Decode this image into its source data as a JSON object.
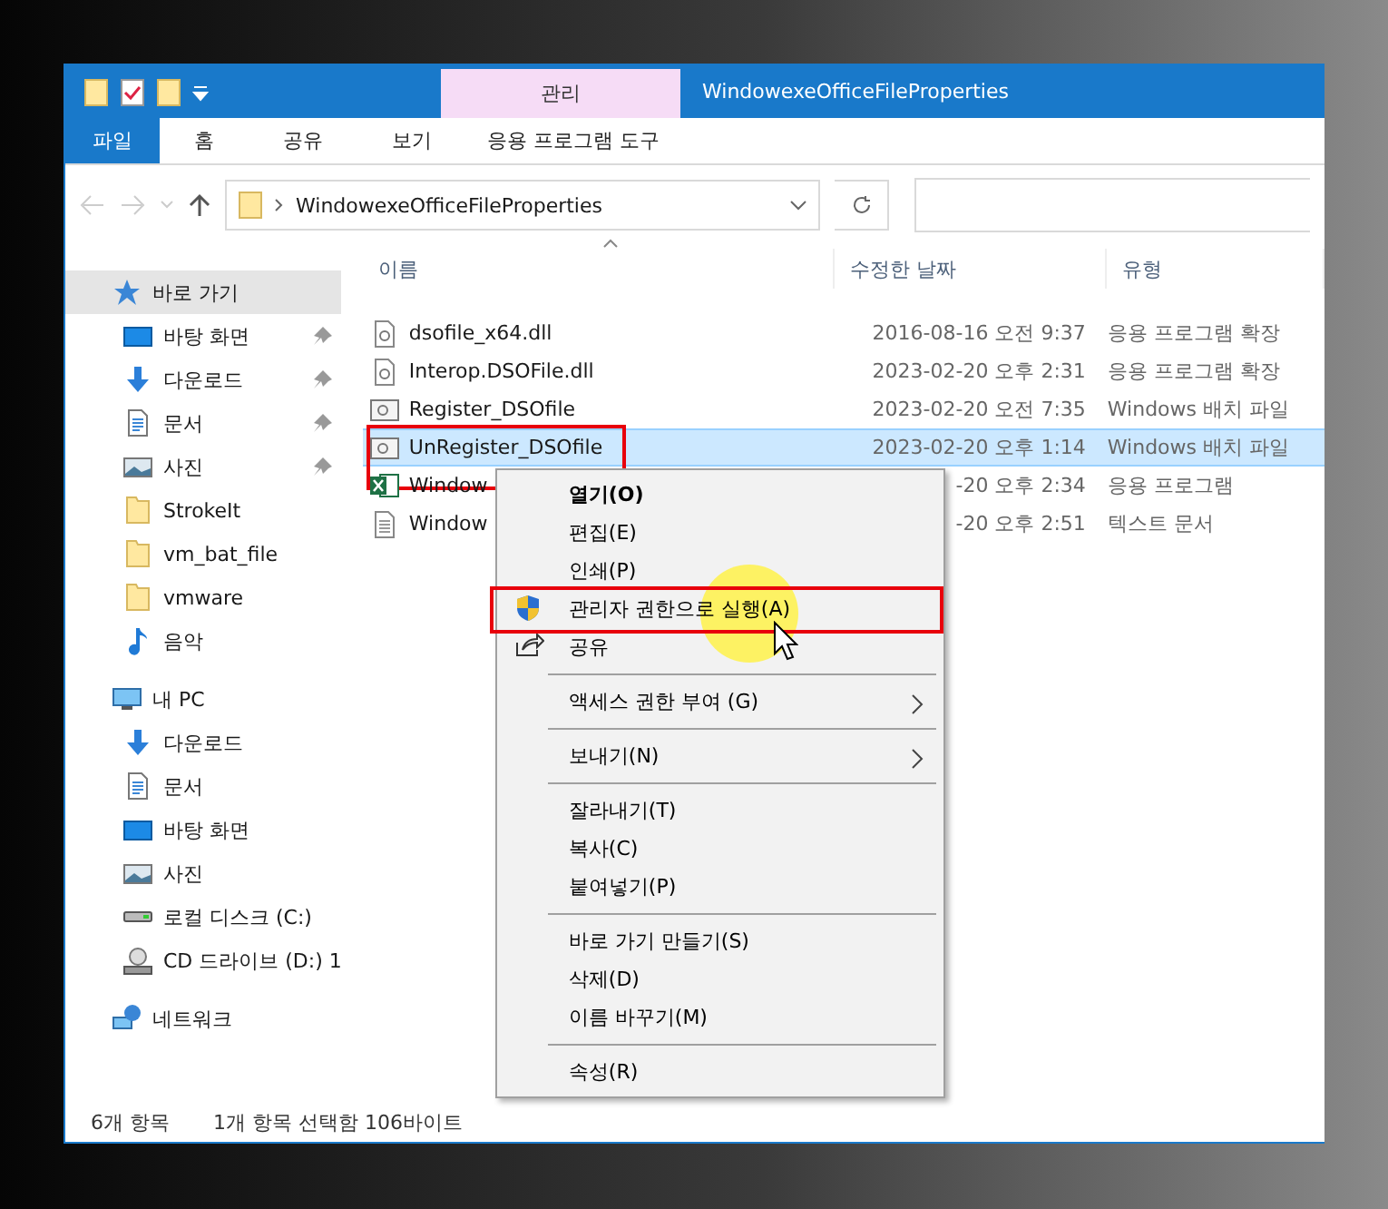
{
  "window": {
    "title": "WindowexeOfficeFileProperties"
  },
  "ribbon": {
    "context_group": "관리",
    "context_tab": "응용 프로그램 도구",
    "tabs": [
      {
        "label": "파일",
        "kind": "file"
      },
      {
        "label": "홈",
        "kind": "tab"
      },
      {
        "label": "공유",
        "kind": "tab"
      },
      {
        "label": "보기",
        "kind": "tab"
      }
    ]
  },
  "address_bar": {
    "path": "WindowexeOfficeFileProperties"
  },
  "navigation": {
    "items": [
      {
        "label": "바로 가기",
        "kind": "star",
        "selected": true,
        "children": [
          {
            "label": "바탕 화면",
            "kind": "desktop",
            "selected": false,
            "pinned": true
          },
          {
            "label": "다운로드",
            "kind": "download",
            "selected": false,
            "pinned": true
          },
          {
            "label": "문서",
            "kind": "document",
            "selected": false,
            "pinned": true
          },
          {
            "label": "사진",
            "kind": "pictures",
            "selected": false,
            "pinned": true
          },
          {
            "label": "StrokeIt",
            "kind": "folder",
            "selected": false,
            "pinned": false
          },
          {
            "label": "vm_bat_file",
            "kind": "folder",
            "selected": false,
            "pinned": false
          },
          {
            "label": "vmware",
            "kind": "folder",
            "selected": false,
            "pinned": false
          },
          {
            "label": "음악",
            "kind": "music",
            "selected": false,
            "pinned": false
          }
        ]
      },
      {
        "label": "내 PC",
        "kind": "pc",
        "selected": false,
        "children": [
          {
            "label": "다운로드",
            "kind": "download",
            "selected": false,
            "pinned": false
          },
          {
            "label": "문서",
            "kind": "document",
            "selected": false,
            "pinned": false
          },
          {
            "label": "바탕 화면",
            "kind": "desktop",
            "selected": false,
            "pinned": false
          },
          {
            "label": "사진",
            "kind": "pictures",
            "selected": false,
            "pinned": false
          },
          {
            "label": "로컬 디스크 (C:)",
            "kind": "disk",
            "selected": false,
            "pinned": false
          },
          {
            "label": "CD 드라이브 (D:) 1",
            "kind": "cd",
            "selected": false,
            "pinned": false
          }
        ]
      },
      {
        "label": "네트워크",
        "kind": "network",
        "selected": false
      }
    ]
  },
  "files": {
    "columns": [
      {
        "label": "이름",
        "sorted": true
      },
      {
        "label": "수정한 날짜",
        "sorted": false
      },
      {
        "label": "유형",
        "sorted": false
      }
    ],
    "rows": [
      {
        "name": "dsofile_x64.dll",
        "date": "2016-08-16 오전 9:37",
        "type": "응용 프로그램 확장",
        "kind": "dll",
        "selected": false,
        "outlined": false
      },
      {
        "name": "Interop.DSOFile.dll",
        "date": "2023-02-20 오후 2:31",
        "type": "응용 프로그램 확장",
        "kind": "dll",
        "selected": false,
        "outlined": false
      },
      {
        "name": "Register_DSOfile",
        "date": "2023-02-20 오전 7:35",
        "type": "Windows 배치 파일",
        "kind": "bat",
        "selected": false,
        "outlined": false
      },
      {
        "name": "UnRegister_DSOfile",
        "date": "2023-02-20 오후 1:14",
        "type": "Windows 배치 파일",
        "kind": "bat",
        "selected": true,
        "outlined": true
      },
      {
        "name": "Window",
        "date": "-20 오후 2:34",
        "type": "응용 프로그램",
        "kind": "excel",
        "selected": false,
        "outlined": false
      },
      {
        "name": "Window",
        "date": "-20 오후 2:51",
        "type": "텍스트 문서",
        "kind": "text",
        "selected": false,
        "outlined": false
      }
    ]
  },
  "context_menu": {
    "items": [
      {
        "kind": "item",
        "label": "열기(O)",
        "default": true,
        "submenu": false,
        "outlined": false
      },
      {
        "kind": "item",
        "label": "편집(E)",
        "default": false,
        "submenu": false,
        "outlined": false
      },
      {
        "kind": "item",
        "label": "인쇄(P)",
        "default": false,
        "submenu": false,
        "outlined": false
      },
      {
        "kind": "shield",
        "label": "관리자 권한으로 실행(A)",
        "default": false,
        "submenu": false,
        "outlined": true
      },
      {
        "kind": "share",
        "label": "공유",
        "default": false,
        "submenu": false,
        "outlined": false
      },
      {
        "kind": "separator"
      },
      {
        "kind": "item",
        "label": "액세스 권한 부여 (G)",
        "default": false,
        "submenu": true,
        "outlined": false
      },
      {
        "kind": "separator"
      },
      {
        "kind": "item",
        "label": "보내기(N)",
        "default": false,
        "submenu": true,
        "outlined": false
      },
      {
        "kind": "separator"
      },
      {
        "kind": "item",
        "label": "잘라내기(T)",
        "default": false,
        "submenu": false,
        "outlined": false
      },
      {
        "kind": "item",
        "label": "복사(C)",
        "default": false,
        "submenu": false,
        "outlined": false
      },
      {
        "kind": "item",
        "label": "붙여넣기(P)",
        "default": false,
        "submenu": false,
        "outlined": false
      },
      {
        "kind": "separator"
      },
      {
        "kind": "item",
        "label": "바로 가기 만들기(S)",
        "default": false,
        "submenu": false,
        "outlined": false
      },
      {
        "kind": "item",
        "label": "삭제(D)",
        "default": false,
        "submenu": false,
        "outlined": false
      },
      {
        "kind": "item",
        "label": "이름 바꾸기(M)",
        "default": false,
        "submenu": false,
        "outlined": false
      },
      {
        "kind": "separator"
      },
      {
        "kind": "item",
        "label": "속성(R)",
        "default": false,
        "submenu": false,
        "outlined": false
      }
    ]
  },
  "status_bar": {
    "item_count": "6개 항목",
    "selection": "1개 항목 선택함 106바이트"
  }
}
